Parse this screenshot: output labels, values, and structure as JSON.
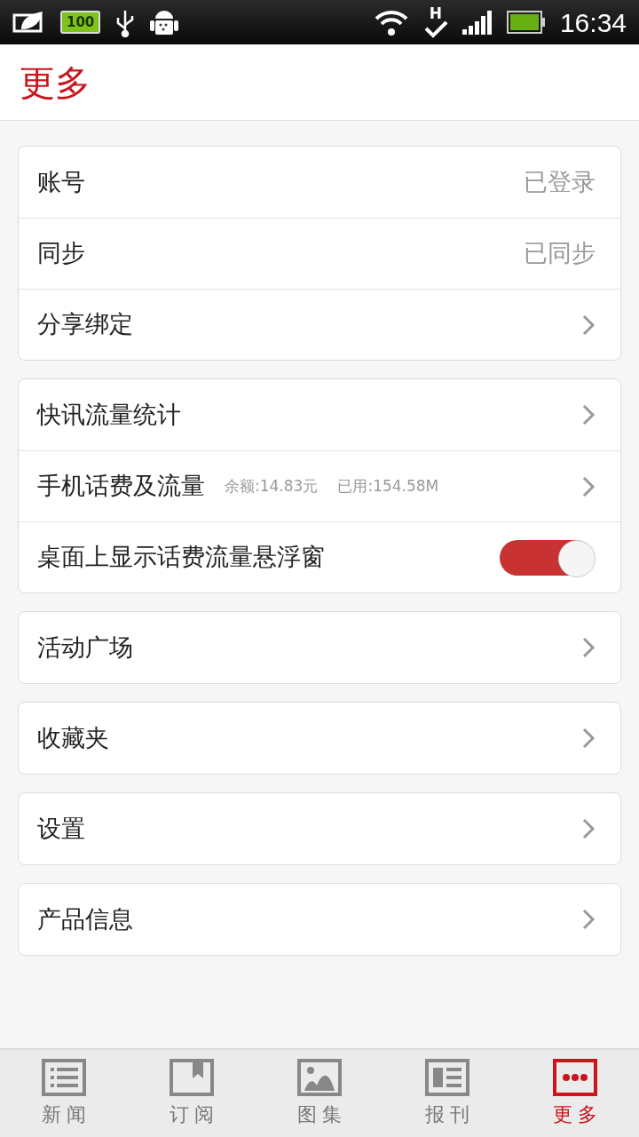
{
  "status_bar": {
    "battery_label": "100",
    "network_label": "H",
    "time": "16:34"
  },
  "header": {
    "title": "更多"
  },
  "groups": [
    {
      "items": [
        {
          "kind": "value",
          "label": "账号",
          "value": "已登录"
        },
        {
          "kind": "value",
          "label": "同步",
          "value": "已同步"
        },
        {
          "kind": "link",
          "label": "分享绑定"
        }
      ]
    },
    {
      "items": [
        {
          "kind": "link",
          "label": "快讯流量统计"
        },
        {
          "kind": "link",
          "label": "手机话费及流量",
          "info": [
            "余额:14.83元",
            "已用:154.58M"
          ]
        },
        {
          "kind": "toggle",
          "label": "桌面上显示话费流量悬浮窗",
          "on": true
        }
      ]
    },
    {
      "items": [
        {
          "kind": "link",
          "label": "活动广场"
        }
      ]
    },
    {
      "items": [
        {
          "kind": "link",
          "label": "收藏夹"
        }
      ]
    },
    {
      "items": [
        {
          "kind": "link",
          "label": "设置"
        }
      ]
    },
    {
      "items": [
        {
          "kind": "link",
          "label": "产品信息"
        }
      ]
    }
  ],
  "bottom_nav": [
    {
      "label": "新 闻",
      "selected": false
    },
    {
      "label": "订 阅",
      "selected": false
    },
    {
      "label": "图 集",
      "selected": false
    },
    {
      "label": "报 刊",
      "selected": false
    },
    {
      "label": "更 多",
      "selected": true
    }
  ]
}
